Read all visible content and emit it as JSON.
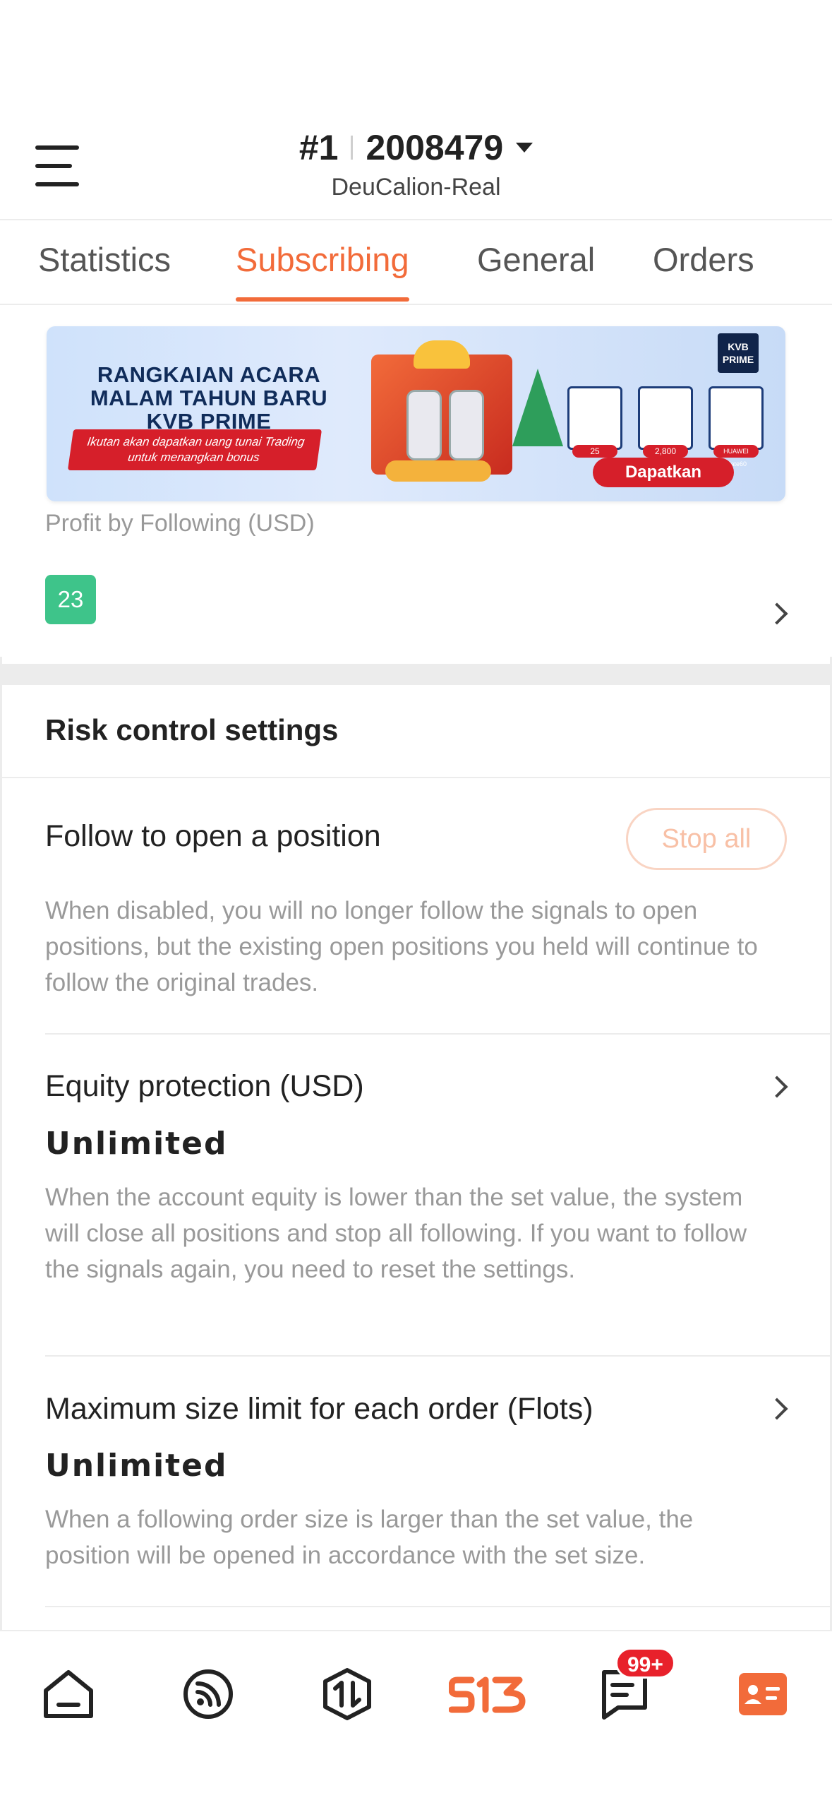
{
  "header": {
    "account_rank": "#1",
    "account_number": "2008479",
    "account_name": "DeuCalion-Real"
  },
  "tabs": [
    {
      "label": "Statistics",
      "active": false
    },
    {
      "label": "Subscribing",
      "active": true
    },
    {
      "label": "General",
      "active": false
    },
    {
      "label": "Orders",
      "active": false
    }
  ],
  "banner": {
    "title": "RANGKAIAN ACARA MALAM TAHUN BARU KVB PRIME",
    "ribbon_text": "Ikutan akan dapatkan uang tunai Trading untuk menangkan bonus",
    "brand": "KVB PRIME",
    "prizes": [
      "25",
      "2,800",
      "HUAWEI Mate60"
    ],
    "button_label": "Dapatkan"
  },
  "profit": {
    "label": "Profit by Following (USD)",
    "badge": "23"
  },
  "risk": {
    "title": "Risk control settings",
    "follow_open": {
      "title": "Follow to open a position",
      "button": "Stop all",
      "description": "When disabled, you will no longer follow the signals to open positions, but the existing open positions you held will continue to follow the original trades."
    },
    "equity_protection": {
      "title": "Equity protection (USD)",
      "value": "Unlimited",
      "description": "When the account equity is lower than the set value, the system will close all positions and stop all following. If you want to follow the signals again, you need to reset the settings."
    },
    "max_size": {
      "title": "Maximum size limit for each order (Flots)",
      "value": "Unlimited",
      "description": "When a following order size is larger than the set value, the position will be opened in accordance with the set size."
    }
  },
  "bottom_nav": {
    "items": [
      "home-icon",
      "signal-feed-icon",
      "trade-icon",
      "s13-logo-icon",
      "messages-icon",
      "profile-card-icon"
    ],
    "message_badge": "99+",
    "brand_text": "S13"
  },
  "colors": {
    "accent": "#f26b3a",
    "badge_green": "#3ec48a",
    "notification_red": "#e8212b"
  }
}
